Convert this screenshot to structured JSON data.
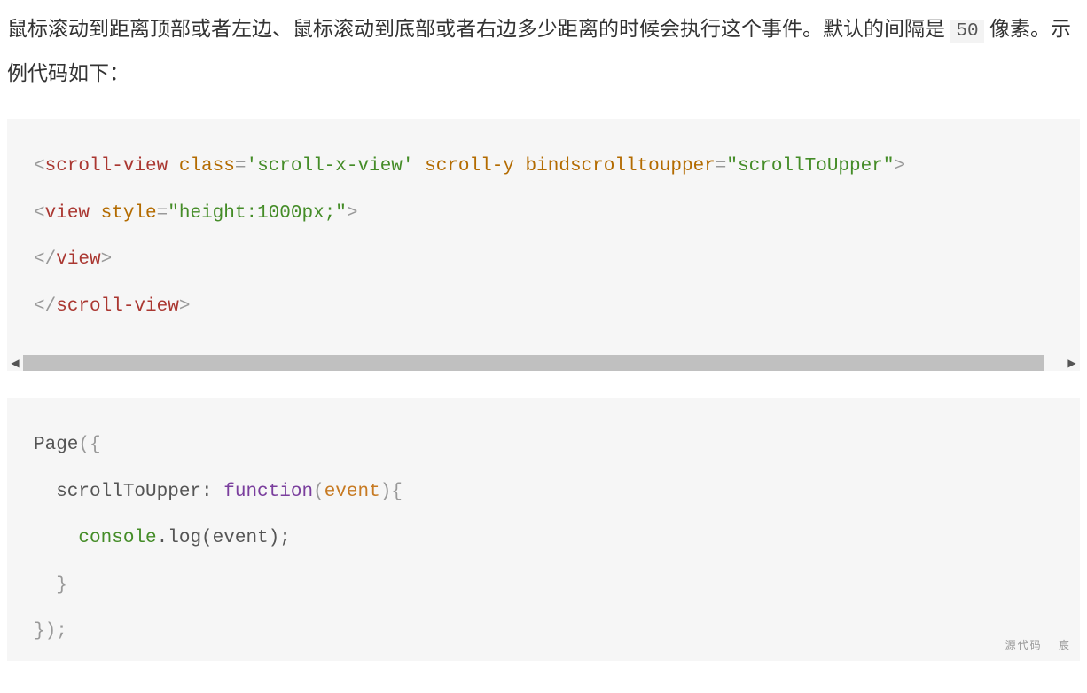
{
  "paragraph": {
    "before_code": "鼠标滚动到距离顶部或者左边、鼠标滚动到底部或者右边多少距离的时候会执行这个事件。默认的间隔是 ",
    "code": "50",
    "after_code": " 像素。示例代码如下："
  },
  "code1": {
    "line1": {
      "open": "<",
      "tag": "scroll-view",
      "attr1_name": "class",
      "attr1_eq": "=",
      "attr1_val": "'scroll-x-view'",
      "attr2_name": "scroll-y",
      "attr3_name": "bindscrolltoupper",
      "attr3_eq": "=",
      "attr3_val": "\"scrollToUpper\"",
      "close": ">"
    },
    "line2": {
      "open": "<",
      "tag": "view",
      "attr1_name": "style",
      "attr1_eq": "=",
      "attr1_val": "\"height:1000px;\"",
      "close": ">"
    },
    "line3": {
      "open": "</",
      "tag": "view",
      "close": ">"
    },
    "line4": {
      "open": "</",
      "tag": "scroll-view",
      "close": ">"
    }
  },
  "code2": {
    "l1_a": "Page",
    "l1_b": "({",
    "l2_a": "  scrollToUpper: ",
    "l2_b": "function",
    "l2_c": "(",
    "l2_d": "event",
    "l2_e": "){",
    "l3_a": "    ",
    "l3_b": "console",
    "l3_c": ".log(event);",
    "l4": "  }",
    "l5": "});"
  },
  "watermark": "源代码  宸"
}
